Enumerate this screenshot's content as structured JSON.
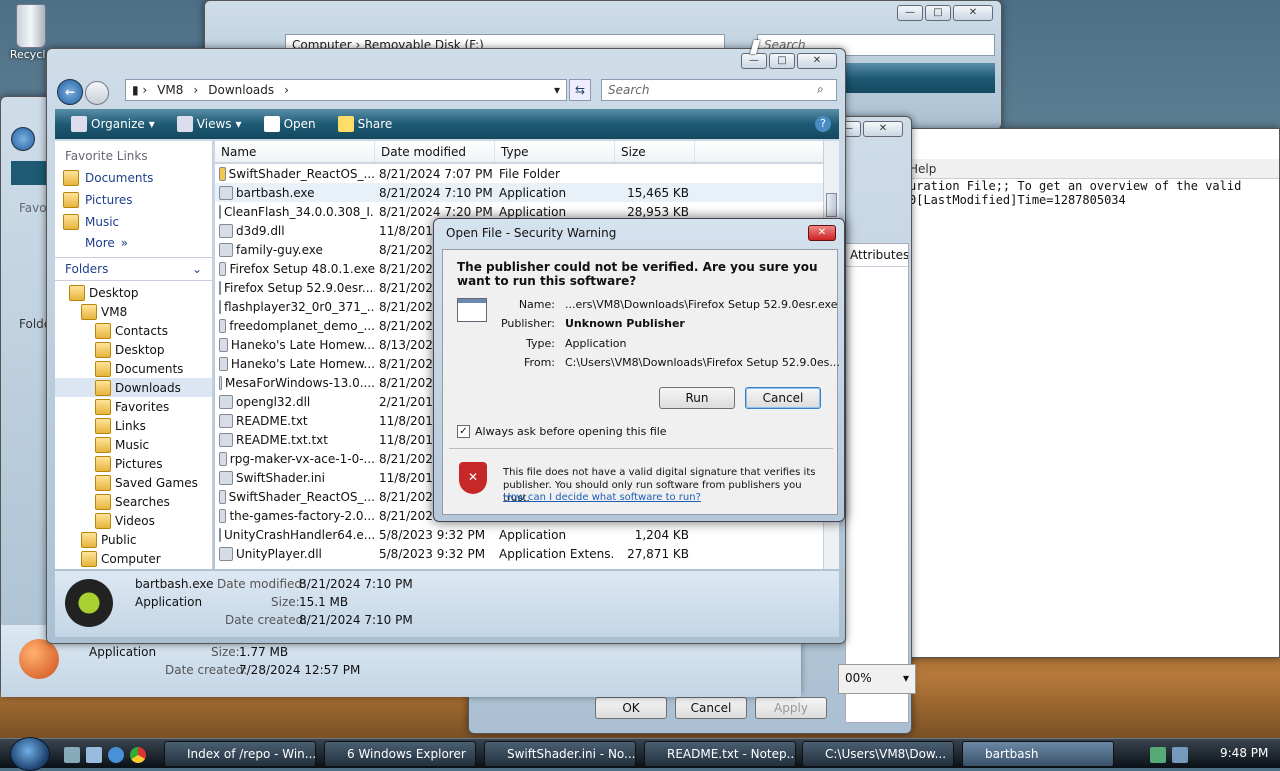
{
  "desktop": {
    "recycle_label": "Recycle"
  },
  "back_window": {
    "address": "Computer  ›  Removable Disk (F:)",
    "search_placeholder": "Search"
  },
  "notepad": {
    "menu_help": "Help",
    "line1": "uration File;; To get an overview of the valid",
    "line2": "0[LastModified]Time=1287805034",
    "attr_header": "Attributes",
    "zoom": "00%"
  },
  "props": {
    "ok": "OK",
    "cancel": "Cancel",
    "apply": "Apply"
  },
  "left_window": {
    "details_type": "Application",
    "size_label": "Size:",
    "size_value": "1.77 MB",
    "created_label": "Date created:",
    "created_value": "7/28/2024 12:57 PM",
    "fav_label": "Favor",
    "folders_label": "Folde"
  },
  "explorer": {
    "breadcrumb": [
      "VM8",
      "Downloads"
    ],
    "search_placeholder": "Search",
    "toolbar": {
      "organize": "Organize",
      "views": "Views",
      "open": "Open",
      "share": "Share"
    },
    "favorite_links_title": "Favorite Links",
    "favorite_links": [
      "Documents",
      "Pictures",
      "Music"
    ],
    "more": "More",
    "folders": "Folders",
    "tree": [
      "Desktop",
      "VM8",
      "Contacts",
      "Desktop",
      "Documents",
      "Downloads",
      "Favorites",
      "Links",
      "Music",
      "Pictures",
      "Saved Games",
      "Searches",
      "Videos",
      "Public",
      "Computer"
    ],
    "columns": [
      "Name",
      "Date modified",
      "Type",
      "Size"
    ],
    "files": [
      {
        "name": "SwiftShader_ReactOS_...",
        "date": "8/21/2024 7:07 PM",
        "type": "File Folder",
        "size": ""
      },
      {
        "name": "bartbash.exe",
        "date": "8/21/2024 7:10 PM",
        "type": "Application",
        "size": "15,465 KB"
      },
      {
        "name": "CleanFlash_34.0.0.308_I...",
        "date": "8/21/2024 7:20 PM",
        "type": "Application",
        "size": "28,953 KB"
      },
      {
        "name": "d3d9.dll",
        "date": "11/8/2017",
        "type": "",
        "size": ""
      },
      {
        "name": "family-guy.exe",
        "date": "8/21/2024",
        "type": "",
        "size": ""
      },
      {
        "name": "Firefox Setup 48.0.1.exe",
        "date": "8/21/2024",
        "type": "",
        "size": ""
      },
      {
        "name": "Firefox Setup 52.9.0esr....",
        "date": "8/21/2024",
        "type": "",
        "size": ""
      },
      {
        "name": "flashplayer32_0r0_371_...",
        "date": "8/21/2024",
        "type": "",
        "size": ""
      },
      {
        "name": "freedomplanet_demo_...",
        "date": "8/21/2024",
        "type": "",
        "size": ""
      },
      {
        "name": "Haneko's Late Homew...",
        "date": "8/13/2024",
        "type": "",
        "size": ""
      },
      {
        "name": "Haneko's Late Homew...",
        "date": "8/21/2024",
        "type": "",
        "size": ""
      },
      {
        "name": "MesaForWindows-13.0....",
        "date": "8/21/2024",
        "type": "",
        "size": ""
      },
      {
        "name": "opengl32.dll",
        "date": "2/21/2017",
        "type": "",
        "size": ""
      },
      {
        "name": "README.txt",
        "date": "11/8/2017",
        "type": "",
        "size": ""
      },
      {
        "name": "README.txt.txt",
        "date": "11/8/2017",
        "type": "",
        "size": ""
      },
      {
        "name": "rpg-maker-vx-ace-1-0-...",
        "date": "8/21/2024",
        "type": "",
        "size": ""
      },
      {
        "name": "SwiftShader.ini",
        "date": "11/8/2017",
        "type": "",
        "size": ""
      },
      {
        "name": "SwiftShader_ReactOS_...",
        "date": "8/21/2024",
        "type": "",
        "size": ""
      },
      {
        "name": "the-games-factory-2.0...",
        "date": "8/21/2024",
        "type": "",
        "size": ""
      },
      {
        "name": "UnityCrashHandler64.e...",
        "date": "5/8/2023 9:32 PM",
        "type": "Application",
        "size": "1,204 KB"
      },
      {
        "name": "UnityPlayer.dll",
        "date": "5/8/2023 9:32 PM",
        "type": "Application Extens...",
        "size": "27,871 KB"
      }
    ],
    "details": {
      "name": "bartbash.exe",
      "type": "Application",
      "modified_label": "Date modified:",
      "modified_value": "8/21/2024 7:10 PM",
      "size_label": "Size:",
      "size_value": "15.1 MB",
      "created_label": "Date created:",
      "created_value": "8/21/2024 7:10 PM"
    }
  },
  "dialog": {
    "title": "Open File - Security Warning",
    "question": "The publisher could not be verified.  Are you sure you want to run this software?",
    "name_label": "Name:",
    "name_value": "...ers\\VM8\\Downloads\\Firefox Setup 52.9.0esr.exe",
    "publisher_label": "Publisher:",
    "publisher_value": "Unknown Publisher",
    "type_label": "Type:",
    "type_value": "Application",
    "from_label": "From:",
    "from_value": "C:\\Users\\VM8\\Downloads\\Firefox Setup 52.9.0es...",
    "run": "Run",
    "cancel": "Cancel",
    "checkbox_label": "Always ask before opening this file",
    "warning_text": "This file does not have a valid digital signature that verifies its publisher.  You should only run software from publishers you trust.",
    "help_link": "How can I decide what software to run?"
  },
  "taskbar": {
    "items": [
      "Index of /repo - Win...",
      "6 Windows Explorer",
      "SwiftShader.ini - No...",
      "README.txt - Notep...",
      "C:\\Users\\VM8\\Dow...",
      "bartbash"
    ],
    "clock": "9:48 PM"
  }
}
